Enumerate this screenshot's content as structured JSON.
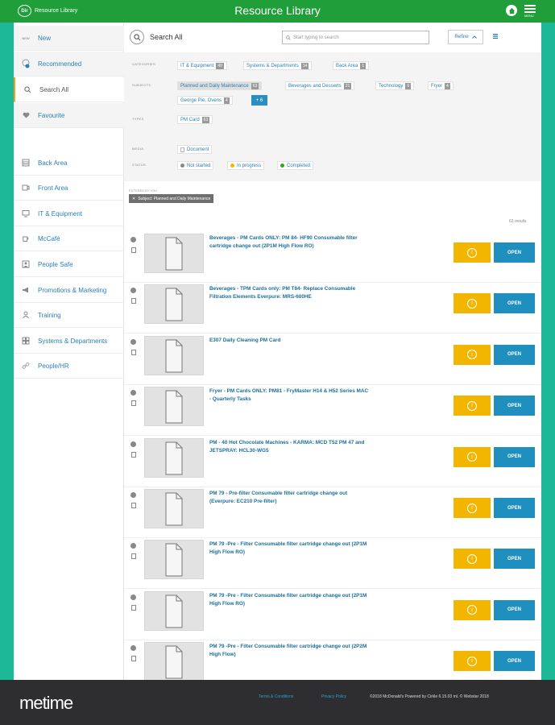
{
  "header": {
    "brand_badge": "Dir",
    "brand_text": "Resource Library",
    "title": "Resource Library",
    "menu_caption": "MENU"
  },
  "sidebar": {
    "new_badge": "NEW",
    "items": [
      {
        "label": "New"
      },
      {
        "label": "Recommended"
      },
      {
        "label": "Search All"
      },
      {
        "label": "Favourite"
      },
      {
        "label": "Back Area"
      },
      {
        "label": "Front Area"
      },
      {
        "label": "IT & Equipment"
      },
      {
        "label": "McCafé"
      },
      {
        "label": "People Safe"
      },
      {
        "label": "Promotions & Marketing"
      },
      {
        "label": "Training"
      },
      {
        "label": "Systems & Departments"
      },
      {
        "label": "People/HR"
      }
    ]
  },
  "search": {
    "title": "Search All",
    "placeholder": "Start typing to search",
    "refine_label": "Refine"
  },
  "filters": {
    "categories_label": "CATEGORIES",
    "categories": [
      {
        "label": "IT & Equipment",
        "count": "49"
      },
      {
        "label": "Systems & Departments",
        "count": "14"
      },
      {
        "label": "Back Area",
        "count": "1"
      }
    ],
    "subjects_label": "SUBJECTS",
    "subjects": [
      {
        "label": "Planned and Daily Maintenance",
        "count": "63"
      },
      {
        "label": "Beverages and Desserts",
        "count": "21"
      },
      {
        "label": "Technology",
        "count": "6"
      },
      {
        "label": "Fryer",
        "count": "4"
      },
      {
        "label": "George Pie, Ovens",
        "count": "4"
      }
    ],
    "subjects_more": "+ 6",
    "types_label": "TYPES",
    "types": [
      {
        "label": "PM Card",
        "count": "63"
      }
    ],
    "media_label": "MEDIA",
    "media": [
      {
        "label": "Document"
      }
    ],
    "status_label": "STATUS",
    "statuses": [
      {
        "label": "Not started",
        "color": "#888888"
      },
      {
        "label": "In progress",
        "color": "#f2b600"
      },
      {
        "label": "Completed",
        "color": "#2aa52a"
      }
    ]
  },
  "filtered_by_label": "FILTERED BY YOU",
  "active_filter": "Subject: Planned and Daily Maintenance",
  "results_count": "63 results",
  "results": [
    {
      "title": "Beverages - PM Cards ONLY: PM 84- HF90 Consumable filter cartridge change out (2P1M High Flow RO)"
    },
    {
      "title": "Beverages - TPM Cards only: PM T84- Replace Consumable Filtration Elements Everpure: MRS-600HE"
    },
    {
      "title": "E307 Daily Cleaning PM Card"
    },
    {
      "title": "Fryer - PM Cards ONLY: PM81 - FryMaster H14 & H52 Series MAC - Quarterly Tasks"
    },
    {
      "title": "PM - 40 Hot Chocolate Machines - KARMA: MCD T52 PM 47 and JETSPRAY: HCL30-WG5"
    },
    {
      "title": "PM 79 - Pre-filter Consumable filter cartridge change out (Everpure: EC210 Pre-filter)"
    },
    {
      "title": "PM 79 -Pre - Filter Consumable filter cartridge change out (2P1M High Flow RO)"
    },
    {
      "title": "PM 79 -Pre - Filter Consumable filter cartridge change out (2P1M High Flow RO)"
    },
    {
      "title": "PM 79 -Pre - Filter Consumable filter cartridge change out (2P2M High Flow)"
    }
  ],
  "open_label": "OPEN",
  "footer": {
    "logo_me": "me",
    "logo_time": "time",
    "terms": "Terms & Conditions",
    "privacy": "Privacy Policy",
    "copyright": "©2018 McDonald's Powered by Cirkle 6.15.03 ml. © Webstar 2018"
  },
  "colors": {
    "header_green": "#1f9e3a",
    "accent_teal": "#1db897",
    "info_yellow": "#f2b600",
    "open_blue": "#1f8fc0"
  }
}
